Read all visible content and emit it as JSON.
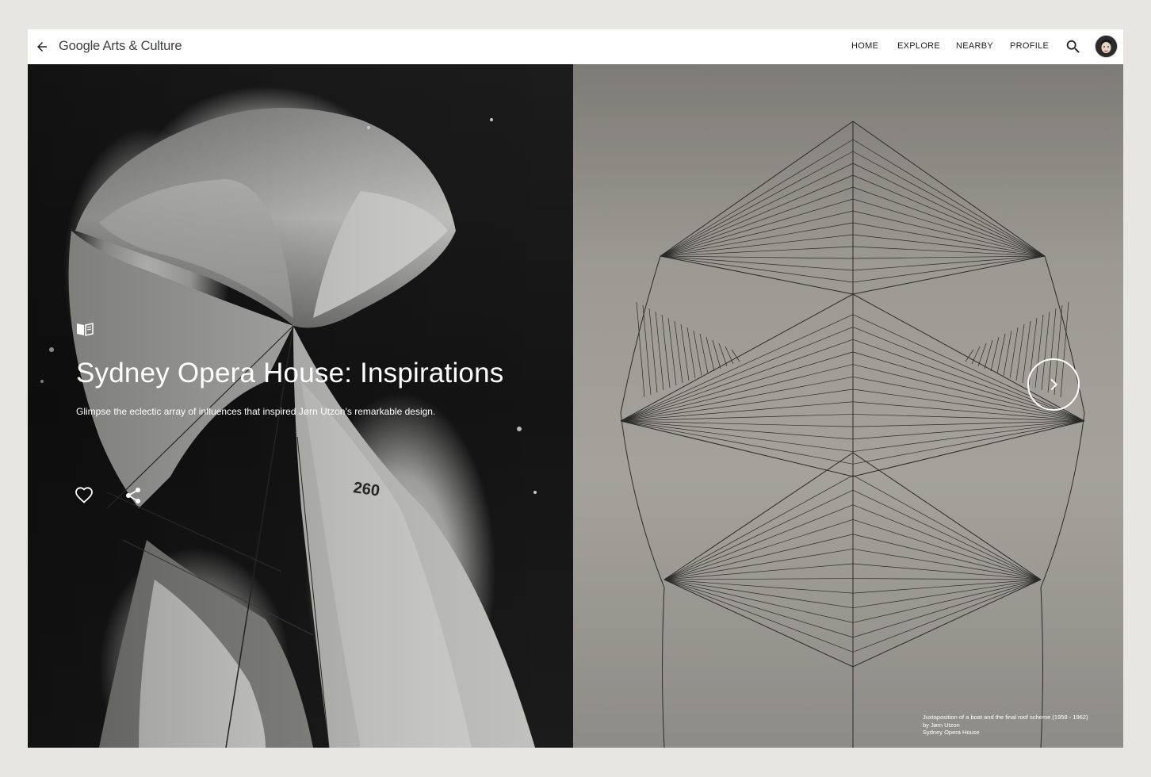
{
  "header": {
    "back_icon": "arrow-back-icon",
    "logo_google": "Google",
    "logo_rest": "Arts & Culture",
    "nav": [
      "HOME",
      "EXPLORE",
      "NEARBY",
      "PROFILE"
    ],
    "search_icon": "search-icon",
    "avatar": "profile-avatar"
  },
  "hero": {
    "story_icon": "story-book-icon",
    "title": "Sydney Opera House: Inspirations",
    "subtitle": "Glimpse the eclectic array of influences that inspired Jørn Utzon’s remarkable design.",
    "like_icon": "heart-icon",
    "share_icon": "share-icon",
    "next_icon": "chevron-right-icon",
    "caption": {
      "line1": "Juxtaposition of a boat and the final roof scheme (1958 - 1962)",
      "line2": "by Jørn Utzon",
      "line3": "Sydney Opera House"
    },
    "photo_text": "260"
  },
  "colors": {
    "page_bg": "#e7e6e2",
    "header_bg": "#ffffff",
    "text_dark": "#202124",
    "overlay_text": "#ffffff"
  }
}
